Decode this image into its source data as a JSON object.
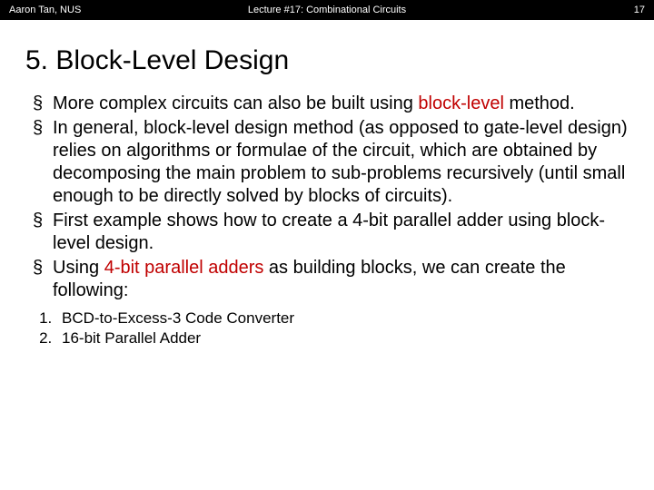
{
  "header": {
    "author": "Aaron Tan, NUS",
    "lecture": "Lecture #17: Combinational Circuits",
    "page": "17"
  },
  "title": "5. Block-Level Design",
  "bullets": [
    {
      "pre": "More complex circuits can also be built using ",
      "highlight": "block-level",
      "post": " method."
    },
    {
      "pre": "In general, block-level design method (as opposed to gate-level design) relies on algorithms or formulae of the circuit, which are obtained by decomposing the main problem to sub-problems recursively (until small enough to be directly solved by blocks of circuits).",
      "highlight": "",
      "post": ""
    },
    {
      "pre": "First example shows how to create a 4-bit parallel adder using block-level design.",
      "highlight": "",
      "post": ""
    },
    {
      "pre": "Using ",
      "highlight": "4-bit parallel adders",
      "post": " as building blocks, we can create the following:"
    }
  ],
  "sublist": [
    "BCD-to-Excess-3 Code Converter",
    "16-bit Parallel Adder"
  ]
}
